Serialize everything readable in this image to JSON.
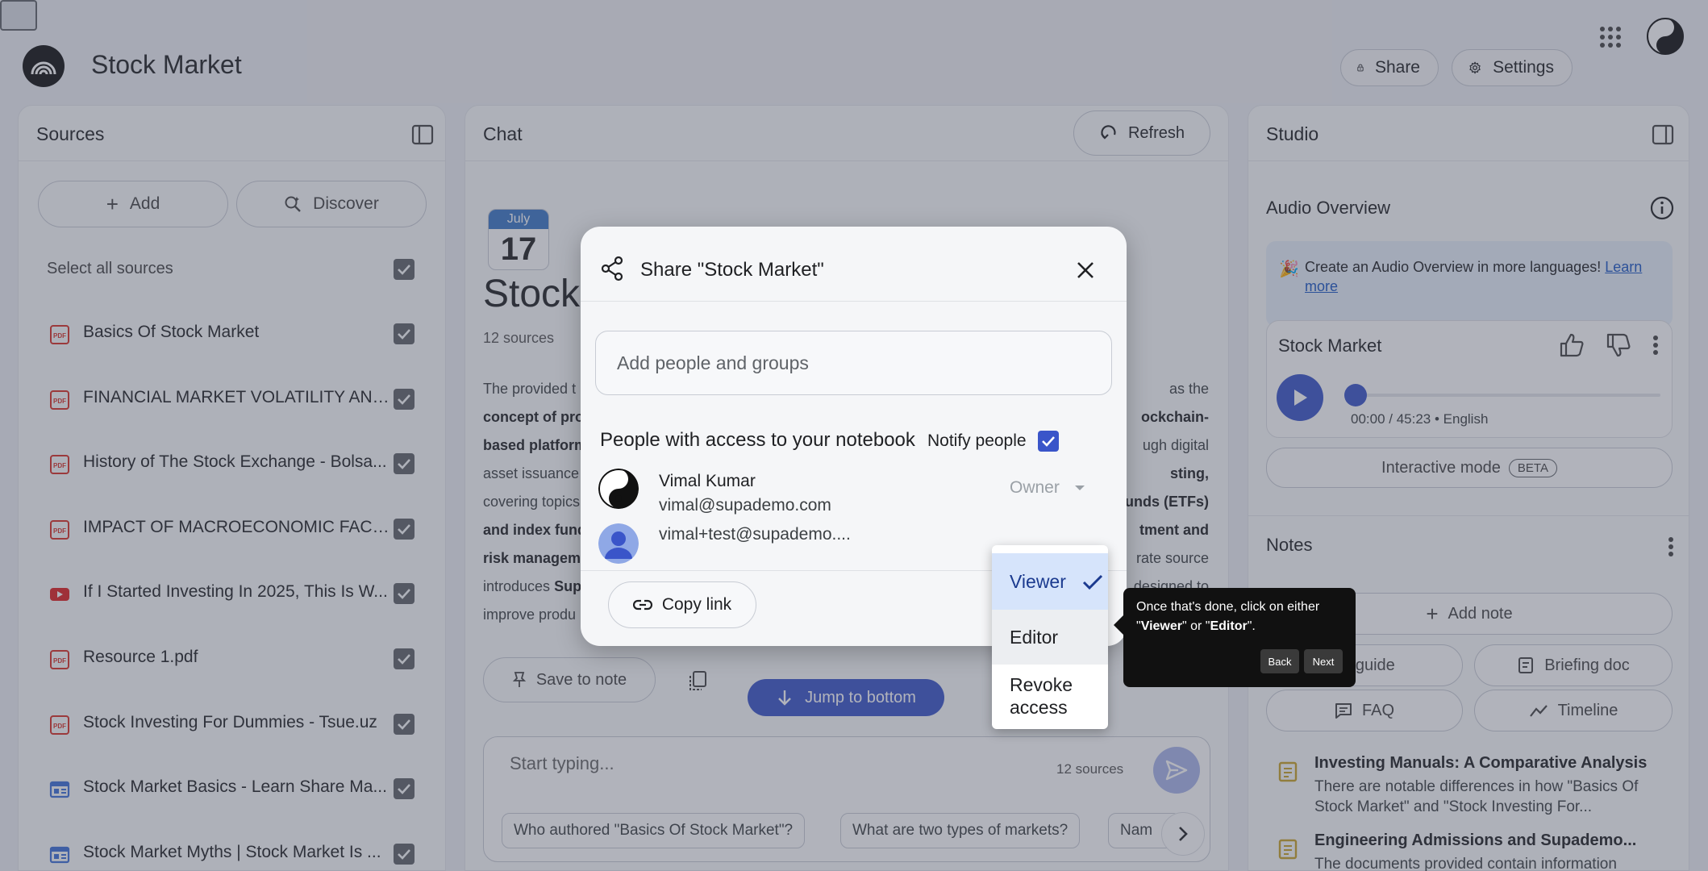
{
  "header": {
    "title": "Stock Market",
    "share_label": "Share",
    "settings_label": "Settings"
  },
  "sources": {
    "title": "Sources",
    "add_label": "Add",
    "discover_label": "Discover",
    "select_all_label": "Select all sources",
    "items": [
      {
        "name": "Basics Of Stock Market",
        "type": "pdf"
      },
      {
        "name": "FINANCIAL MARKET VOLATILITY AND I...",
        "type": "pdf"
      },
      {
        "name": "History of The Stock Exchange - Bolsa...",
        "type": "pdf"
      },
      {
        "name": "IMPACT OF MACROECONOMIC FACTO...",
        "type": "pdf"
      },
      {
        "name": "If I Started Investing In 2025, This Is W...",
        "type": "youtube"
      },
      {
        "name": "Resource 1.pdf",
        "type": "pdf"
      },
      {
        "name": "Stock Investing For Dummies - Tsue.uz",
        "type": "pdf"
      },
      {
        "name": "Stock Market Basics - Learn Share Ma...",
        "type": "web"
      },
      {
        "name": "Stock Market Myths | Stock Market Is ...",
        "type": "web"
      }
    ]
  },
  "chat": {
    "title": "Chat",
    "refresh_label": "Refresh",
    "calendar_month": "July",
    "calendar_day": "17",
    "notebook_title": "Stock",
    "sources_count": "12 sources",
    "summary_lines": {
      "l1_start": "The provided t",
      "l1_end": "as the",
      "l2_start_bold": "concept of pro",
      "l2_end_bold": "ockchain-",
      "l3_start_bold": "based platform",
      "l3_end": "ugh digital",
      "l4_start": "asset issuance",
      "l4_end_bold": "sting,",
      "l4_end_rest": "",
      "l5_start": "covering topics",
      "l5_end_bold": "unds (ETFs)",
      "l6_start_bold": "and index fund",
      "l6_end_bold": "tment and",
      "l7_start_bold": "risk managem",
      "l7_end": "rate source",
      "l8_start": "introduces",
      "l8_start_bold": "Sup",
      "l8_end": "designed to",
      "l9_start": "improve produ"
    },
    "save_note_label": "Save to note",
    "jump_label": "Jump to bottom",
    "composer_placeholder": "Start typing...",
    "composer_sources": "12 sources",
    "suggestions": [
      "Who authored \"Basics Of Stock Market\"?",
      "What are two types of markets?",
      "Nam"
    ]
  },
  "studio": {
    "title": "Studio",
    "audio_overview_title": "Audio Overview",
    "banner_text": "Create an Audio Overview in more languages!",
    "banner_link": "Learn more",
    "audio_card_title": "Stock Market",
    "audio_meta": "00:00 / 45:23 • English",
    "audio_progress": 0,
    "interactive_label": "Interactive mode",
    "beta_label": "BETA",
    "notes_title": "Notes",
    "add_note_label": "Add note",
    "study_guide_label": "dy guide",
    "briefing_label": "Briefing doc",
    "faq_label": "FAQ",
    "timeline_label": "Timeline",
    "notes": [
      {
        "title": "Investing Manuals: A Comparative Analysis",
        "desc": "There are notable differences in how \"Basics Of Stock Market\" and \"Stock Investing For..."
      },
      {
        "title": "Engineering Admissions and Supademo...",
        "desc": "The documents provided contain information"
      }
    ]
  },
  "share_dialog": {
    "title": "Share \"Stock Market\"",
    "add_people_placeholder": "Add people and groups",
    "access_label": "People with access to your notebook",
    "notify_label": "Notify people",
    "people": [
      {
        "name": "Vimal Kumar",
        "email": "vimal@supademo.com",
        "role": "Owner"
      },
      {
        "name": "",
        "email": "vimal+test@supademo....",
        "role": "Viewer"
      }
    ],
    "copy_link_label": "Copy link"
  },
  "role_menu": {
    "options": [
      "Viewer",
      "Editor",
      "Revoke access"
    ],
    "selected": "Viewer"
  },
  "tooltip": {
    "text_before": "Once that's done, click on either \"",
    "viewer": "Viewer",
    "mid": "\" or \"",
    "editor": "Editor",
    "after": "\".",
    "back_label": "Back",
    "next_label": "Next"
  }
}
